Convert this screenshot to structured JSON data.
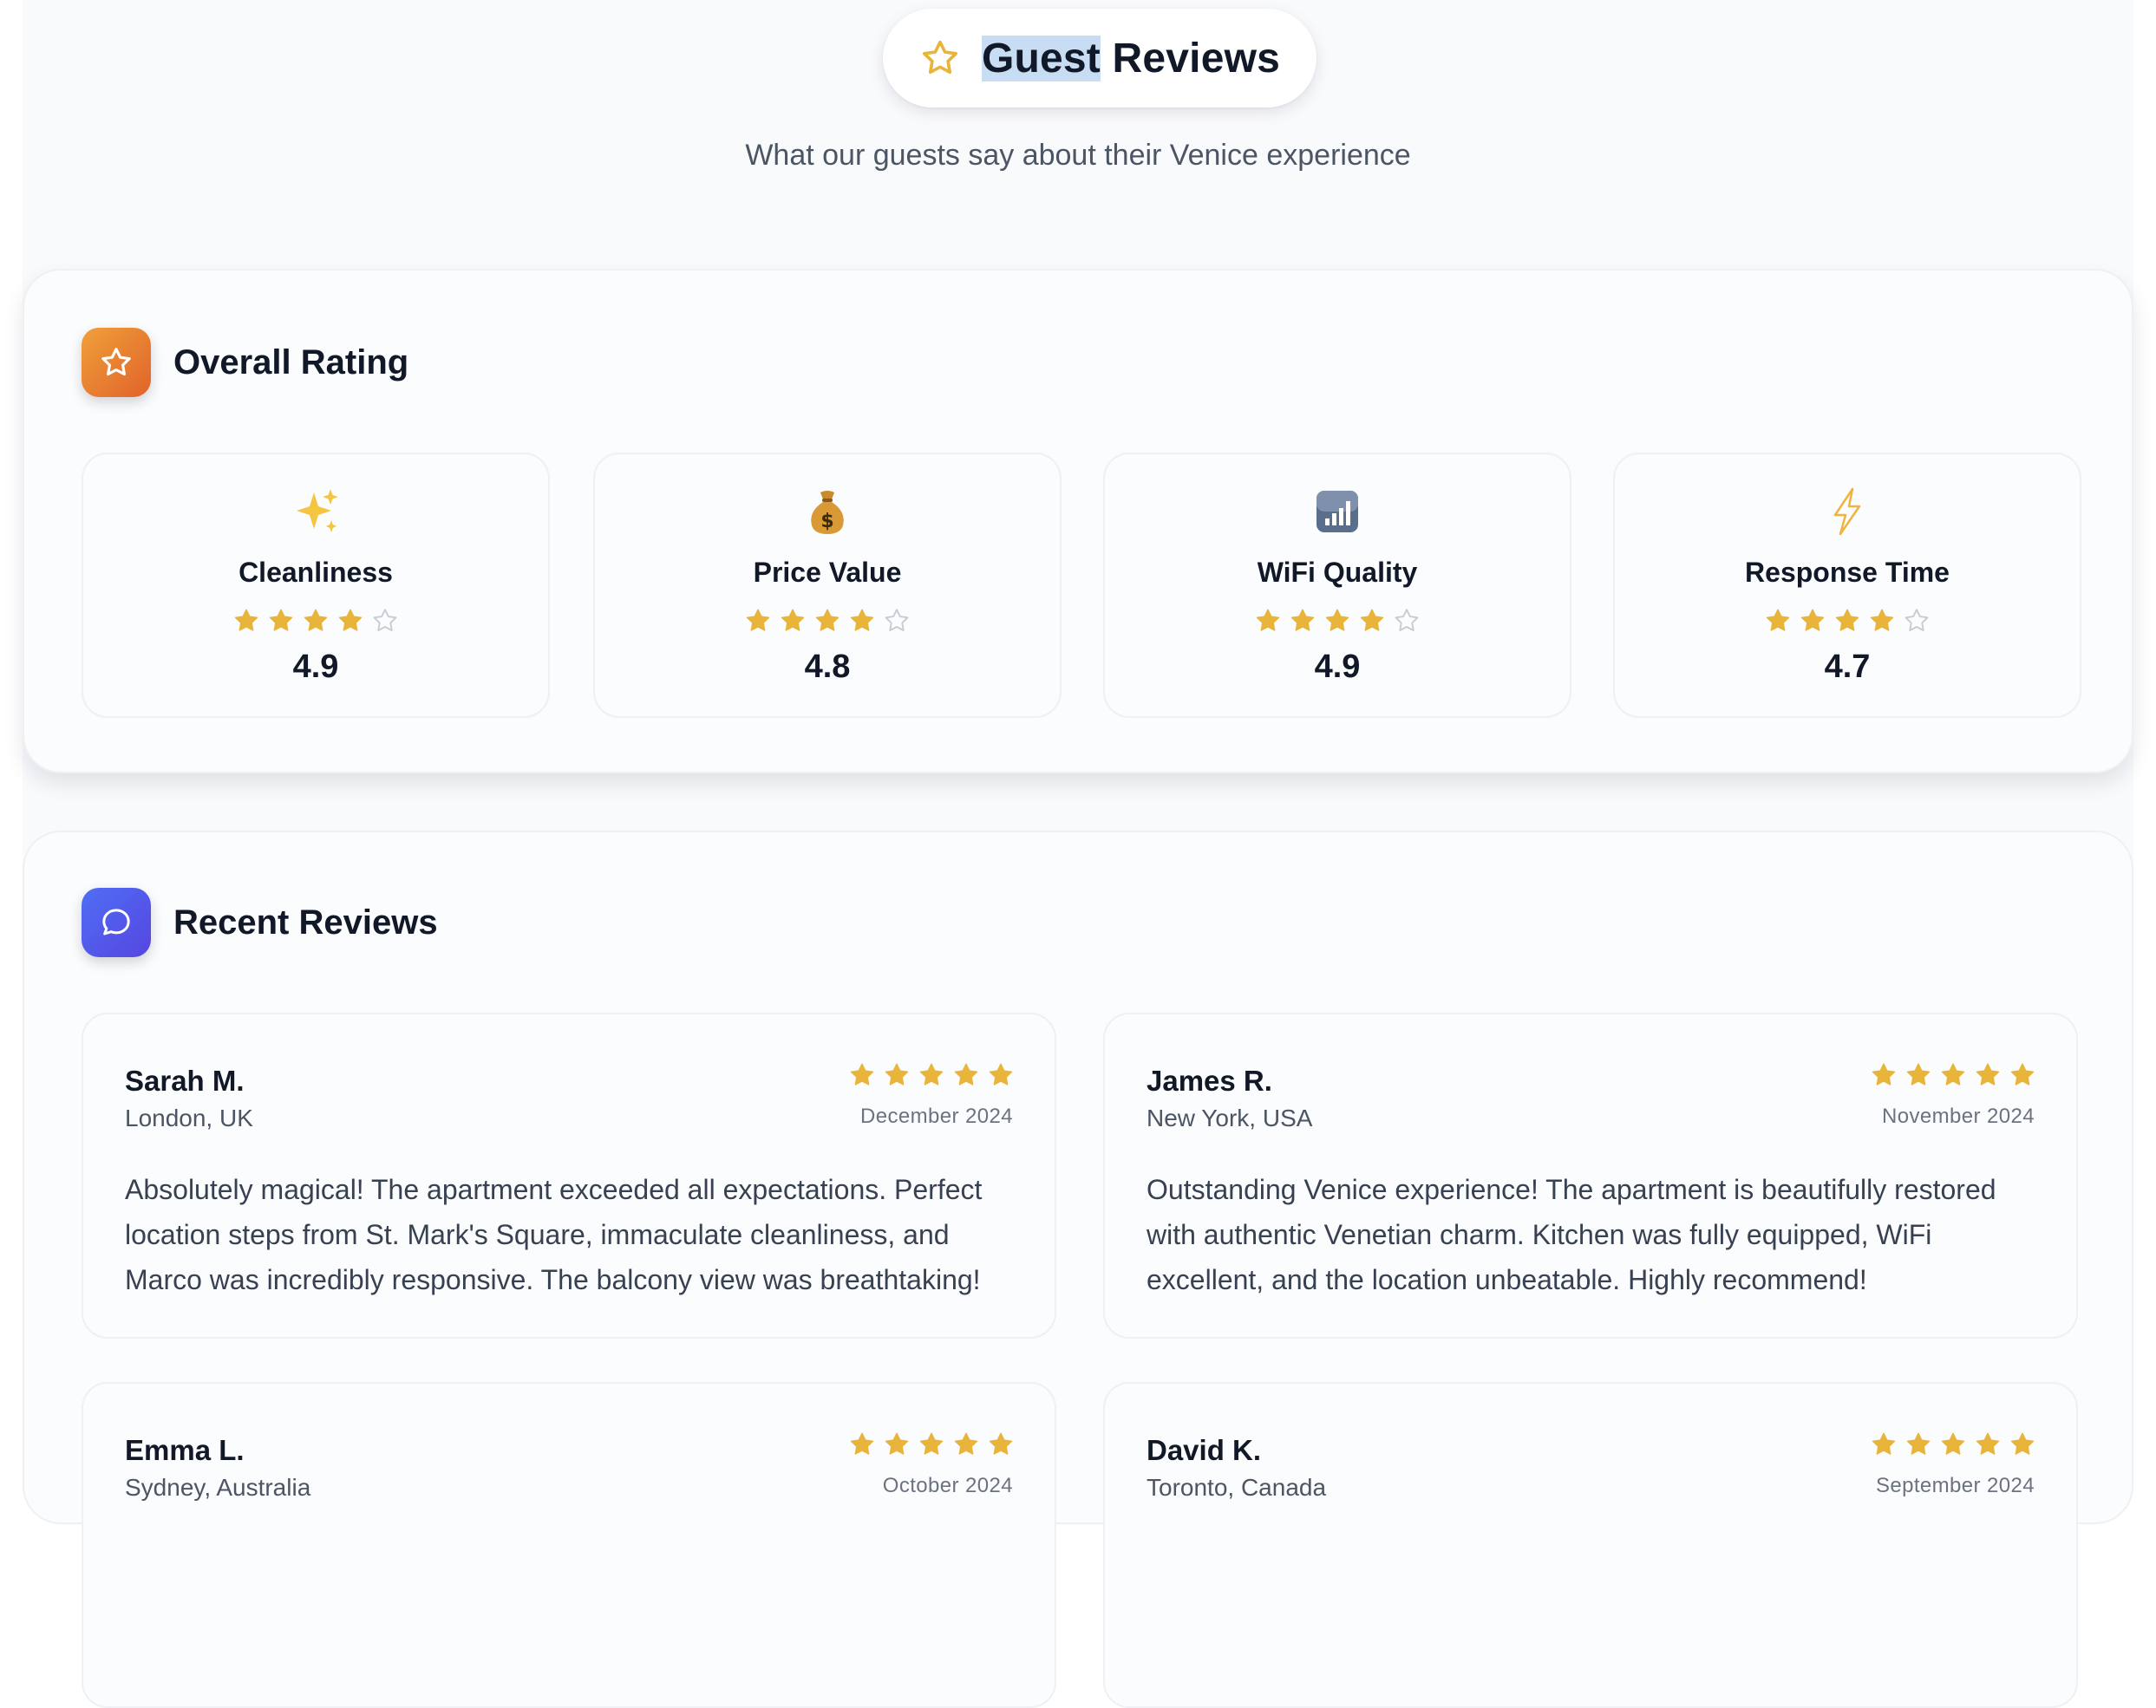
{
  "header": {
    "title_part1": "Guest",
    "title_part2": "Reviews",
    "subtitle": "What our guests say about their Venice experience",
    "icon": "star-outline-icon"
  },
  "overall": {
    "title": "Overall Rating",
    "icon": "star-icon",
    "metrics": [
      {
        "label": "Cleanliness",
        "emoji": "sparkles",
        "stars": 4,
        "score": "4.9"
      },
      {
        "label": "Price Value",
        "emoji": "money-bag",
        "stars": 4,
        "score": "4.8"
      },
      {
        "label": "WiFi Quality",
        "emoji": "signal-bars",
        "stars": 4,
        "score": "4.9"
      },
      {
        "label": "Response Time",
        "emoji": "lightning",
        "stars": 4,
        "score": "4.7"
      }
    ]
  },
  "recent": {
    "title": "Recent Reviews",
    "icon": "chat-bubble-icon",
    "reviews": [
      {
        "name": "Sarah M.",
        "location": "London, UK",
        "date": "December 2024",
        "stars": 5,
        "text": "Absolutely magical! The apartment exceeded all expectations. Perfect location steps from St. Mark's Square, immaculate cleanliness, and Marco was incredibly responsive. The balcony view was breathtaking!"
      },
      {
        "name": "James R.",
        "location": "New York, USA",
        "date": "November 2024",
        "stars": 5,
        "text": "Outstanding Venice experience! The apartment is beautifully restored with authentic Venetian charm. Kitchen was fully equipped, WiFi excellent, and the location unbeatable. Highly recommend!"
      },
      {
        "name": "Emma L.",
        "location": "Sydney, Australia",
        "date": "October 2024",
        "stars": 5,
        "text": ""
      },
      {
        "name": "David K.",
        "location": "Toronto, Canada",
        "date": "September 2024",
        "stars": 5,
        "text": ""
      }
    ]
  },
  "colors": {
    "star_fill": "#e9b43a",
    "star_empty": "#c7ccd4",
    "title_highlight": "#c8dcf4",
    "orange_icon": "#e8812f",
    "blue_icon": "#4f5ef0"
  }
}
